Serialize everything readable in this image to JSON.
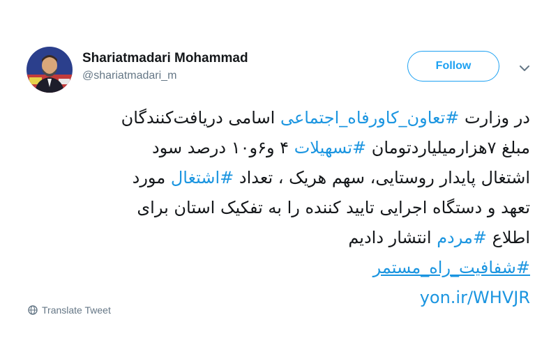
{
  "author": {
    "name": "Shariatmadari Mohammad",
    "handle": "@shariatmadari_m"
  },
  "actions": {
    "follow_label": "Follow",
    "more_icon": "chevron-down-icon"
  },
  "tweet": {
    "lines": [
      [
        {
          "t": "در وزارت "
        },
        {
          "t": "#تعاون_کاورفاه_اجتماعی",
          "h": true
        },
        {
          "t": " اسامی دریافت‌کنندگان"
        }
      ],
      [
        {
          "t": "مبلغ ۷هزارمیلیاردتومان "
        },
        {
          "t": "#تسهیلات",
          "h": true
        },
        {
          "t": " ۴ و۶و۱۰ درصد سود"
        }
      ],
      [
        {
          "t": "اشتغال پایدار روستایی، سهم هریک ، تعداد "
        },
        {
          "t": "#اشتغال",
          "h": true
        },
        {
          "t": " مورد"
        }
      ],
      [
        {
          "t": "تعهد و دستگاه اجرایی تایید کننده را به تفکیک استان برای"
        }
      ],
      [
        {
          "t": "اطلاع "
        },
        {
          "t": "#مردم",
          "h": true
        },
        {
          "t": " انتشار دادیم"
        }
      ],
      [
        {
          "t": "#شفافیت_راه_مستمر",
          "h": true,
          "u": true
        }
      ]
    ],
    "link": "yon.ir/WHVJR"
  },
  "footer": {
    "translate_label": "Translate Tweet",
    "translate_icon": "globe-icon"
  },
  "colors": {
    "accent": "#1da1f2",
    "link": "#1b95e0",
    "text": "#14171a",
    "secondary": "#657786"
  }
}
